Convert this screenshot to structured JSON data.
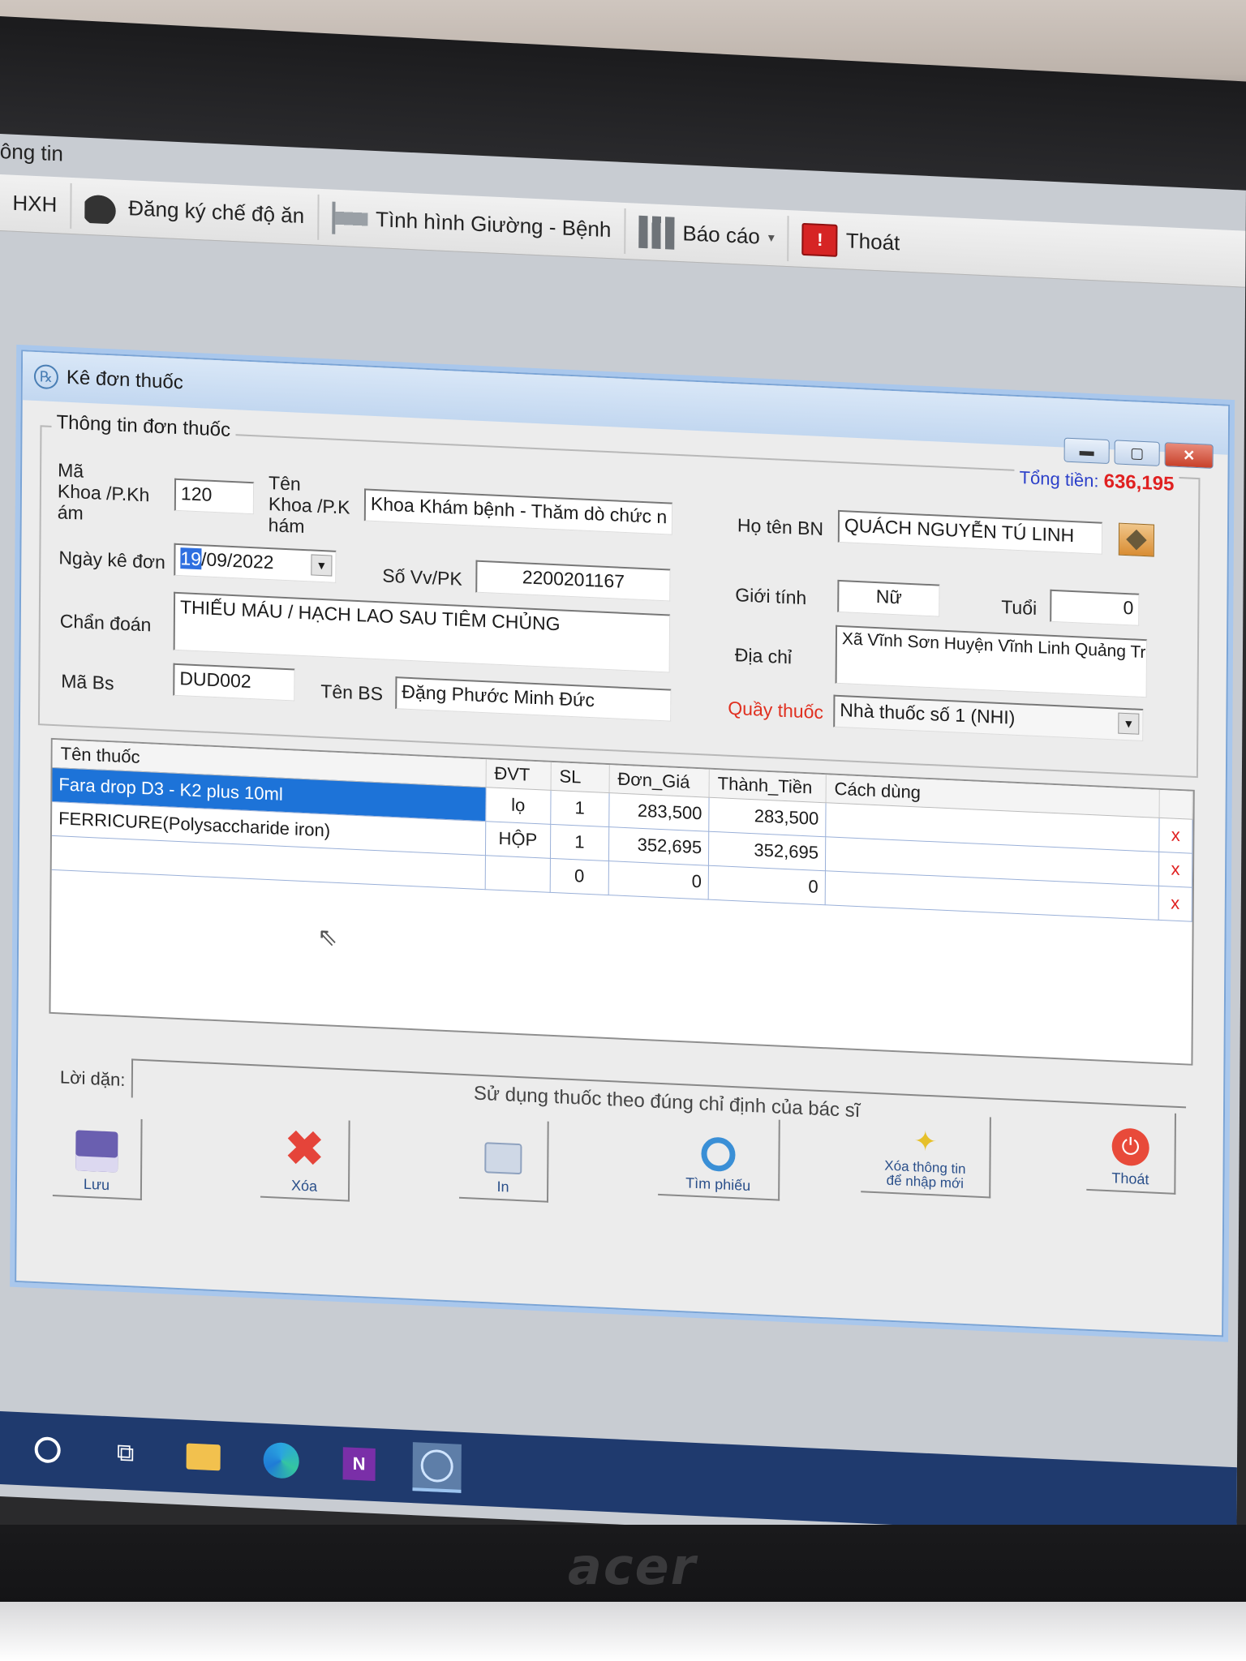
{
  "app": {
    "title_partial": "ông tin",
    "menu": [
      {
        "label": "HXH",
        "icon": ""
      },
      {
        "label": "Đăng ký chế độ ăn",
        "icon": "helmet-icon"
      },
      {
        "label": "Tình hình Giường - Bệnh",
        "icon": "bed-icon"
      },
      {
        "label": "Báo cáo",
        "icon": "report-icon",
        "has_dropdown": true
      },
      {
        "label": "Thoát",
        "icon": "exit-icon"
      }
    ]
  },
  "dialog": {
    "title": "Kê đơn thuốc",
    "group_title": "Thông tin đơn thuốc",
    "total_label": "Tổng tiền:",
    "total_value": "636,195",
    "fields": {
      "ma_khoa_label": "Mã\nKhoa /P.Kh\nám",
      "ma_khoa_value": "120",
      "ten_khoa_label": "Tên\nKhoa /P.K\nhám",
      "ten_khoa_value": "Khoa Khám bệnh - Thăm dò chức n",
      "ho_ten_label": "Họ tên BN",
      "ho_ten_value": "QUÁCH NGUYỄN TÚ LINH",
      "ngay_ke_don_label": "Ngày kê đơn",
      "ngay_ke_don_sel": "19",
      "ngay_ke_don_rest": "/09/2022",
      "so_vv_label": "Số Vv/PK",
      "so_vv_value": "2200201167",
      "gioi_tinh_label": "Giới tính",
      "gioi_tinh_value": "Nữ",
      "tuoi_label": "Tuổi",
      "tuoi_value": "0",
      "chan_doan_label": "Chẩn đoán",
      "chan_doan_value": "THIẾU MÁU / HẠCH LAO SAU TIÊM CHỦNG",
      "dia_chi_label": "Địa chỉ",
      "dia_chi_value": "Xã Vĩnh Sơn Huyện Vĩnh Linh Quảng Trị",
      "ma_bs_label": "Mã Bs",
      "ma_bs_value": "DUD002",
      "ten_bs_label": "Tên BS",
      "ten_bs_value": "Đặng Phước Minh Đức",
      "quay_thuoc_label": "Quầy thuốc",
      "quay_thuoc_value": "Nhà thuốc số 1 (NHI)"
    },
    "grid": {
      "columns": [
        "Tên thuốc",
        "ĐVT",
        "SL",
        "Đơn_Giá",
        "Thành_Tiền",
        "Cách dùng"
      ],
      "rows": [
        {
          "ten": "Fara drop D3 - K2 plus 10ml",
          "dvt": "lọ",
          "sl": "1",
          "don_gia": "283,500",
          "thanh_tien": "283,500",
          "cach_dung": "",
          "del": "x"
        },
        {
          "ten": "FERRICURE(Polysaccharide iron)",
          "dvt": "HỘP",
          "sl": "1",
          "don_gia": "352,695",
          "thanh_tien": "352,695",
          "cach_dung": "",
          "del": "x"
        },
        {
          "ten": "",
          "dvt": "",
          "sl": "0",
          "don_gia": "0",
          "thanh_tien": "0",
          "cach_dung": "",
          "del": "x"
        }
      ]
    },
    "loi_dan_label": "Lời dặn:",
    "loi_dan_value": "Sử dụng thuốc theo đúng chỉ định của bác sĩ",
    "buttons": {
      "luu": "Lưu",
      "xoa": "Xóa",
      "in": "In",
      "tim_phieu": "Tìm phiếu",
      "xoa_thong_tin_1": "Xóa thông tin",
      "xoa_thong_tin_2": "để nhập mới",
      "thoat": "Thoát"
    }
  },
  "hardware": {
    "brand": "acer"
  }
}
